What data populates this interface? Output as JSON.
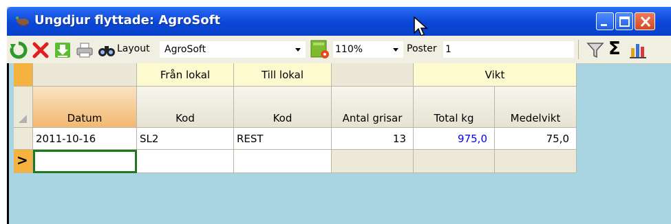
{
  "window": {
    "title": "Ungdjur flyttade: AgroSoft",
    "titlebar_color": "#0a47d6"
  },
  "toolbar": {
    "refresh_icon": "refresh-icon",
    "delete_icon": "delete-icon",
    "download_icon": "download-icon",
    "print_icon": "print-icon",
    "binoculars_icon": "binoculars-icon",
    "layout_label": "Layout",
    "layout_value": "AgroSoft",
    "zoom_value": "110%",
    "poster_label": "Poster",
    "poster_value": "1",
    "filter_icon": "filter-icon",
    "sum_label": "Σ",
    "chart_icon": "bar-chart-icon"
  },
  "grid": {
    "group_headers": {
      "fran": "Från lokal",
      "till": "Till lokal",
      "vikt": "Vikt"
    },
    "columns": {
      "datum": "Datum",
      "fran_kod": "Kod",
      "till_kod": "Kod",
      "antal": "Antal grisar",
      "total": "Total kg",
      "medel": "Medelvikt"
    },
    "rows": [
      {
        "datum": "2011-10-16",
        "fran_kod": "SL2",
        "till_kod": "REST",
        "antal": "13",
        "total": "975,0",
        "medel": "75,0"
      }
    ],
    "new_row_marker": ">",
    "accent_orange": "#f5b23e",
    "value_blue": "#0000ff"
  }
}
